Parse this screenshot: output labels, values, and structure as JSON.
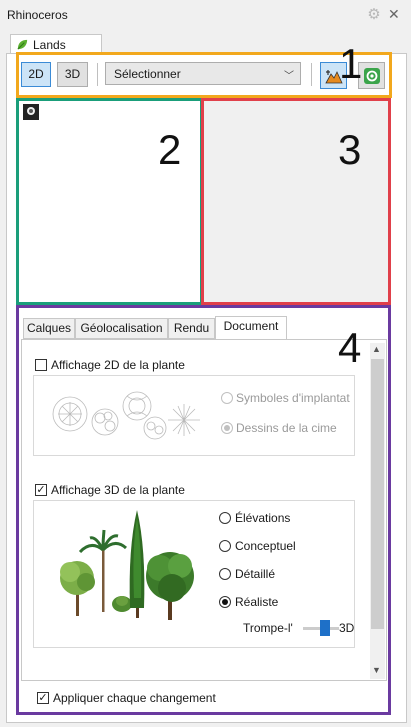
{
  "window": {
    "title": "Rhinoceros"
  },
  "panel_tab": {
    "label": "Lands Design"
  },
  "toolbar": {
    "btn_2d": "2D",
    "btn_3d": "3D",
    "select_value": "Sélectionner"
  },
  "annotations": [
    "1",
    "2",
    "3",
    "4"
  ],
  "colors": {
    "zone1": "#f2a81d",
    "zone2": "#1a9e7a",
    "zone3": "#e0404a",
    "zone4": "#6a3aa0",
    "accent": "#1e70c8"
  },
  "tabs": [
    "Calques",
    "Géolocalisation",
    "Rendu",
    "Document"
  ],
  "selected_tab": "Document",
  "display2d": {
    "label": "Affichage 2D de la plante",
    "checked": false,
    "options": [
      "Symboles d'implantat",
      "Dessins de la cime"
    ],
    "selected": "Dessins de la cime"
  },
  "display3d": {
    "label": "Affichage 3D de la plante",
    "checked": true,
    "options": [
      "Élévations",
      "Conceptuel",
      "Détaillé",
      "Réaliste"
    ],
    "selected": "Réaliste",
    "slider_left": "Trompe-l'",
    "slider_right": "3D"
  },
  "footer": {
    "label": "Appliquer chaque changement",
    "checked": true
  }
}
